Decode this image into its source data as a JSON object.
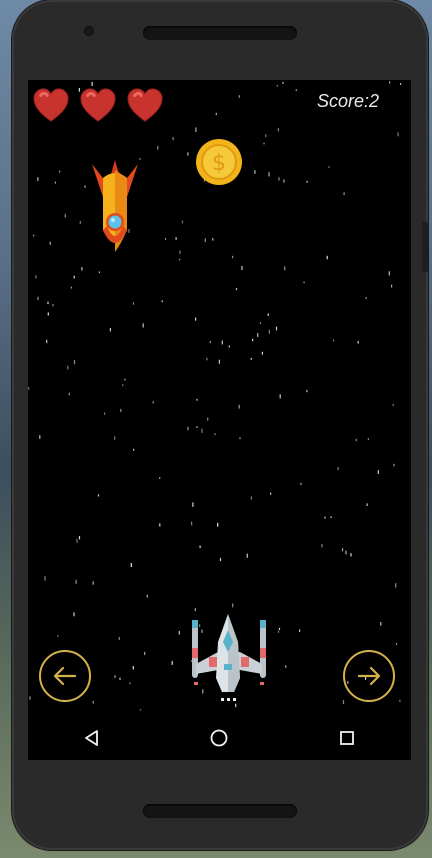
{
  "game": {
    "score_text": "Score:2",
    "lives": 3,
    "icons": {
      "life": "heart-icon",
      "coin": "coin-icon",
      "enemy": "rocket-icon",
      "player": "spaceship-icon",
      "move_left": "arrow-left-icon",
      "move_right": "arrow-right-icon"
    },
    "colors": {
      "heart": "#c9332e",
      "coin": "#f2b31b",
      "control_ring": "#d4b24a",
      "background": "#000000"
    }
  },
  "navbar": {
    "icons": [
      "back-icon",
      "home-icon",
      "recents-icon"
    ]
  }
}
